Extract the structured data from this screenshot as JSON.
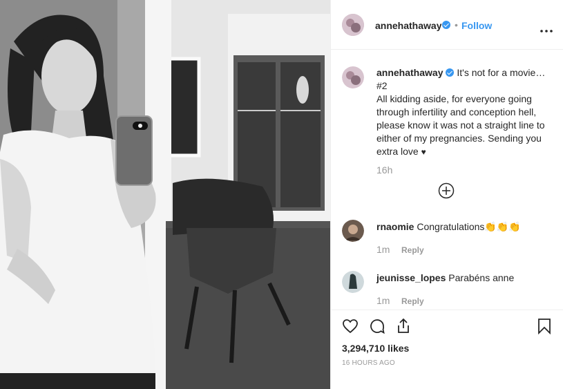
{
  "header": {
    "username": "annehathaway",
    "dot": "•",
    "follow_label": "Follow",
    "more_icon": "more-horizontal-icon"
  },
  "caption": {
    "username": "annehathaway",
    "line1": "It's not for a movie…",
    "line2": "#2",
    "body": "All kidding aside, for everyone going through infertility and conception hell, please know it was not a straight line to either of my pregnancies. Sending you extra love",
    "emoji": "♥",
    "time": "16h"
  },
  "load_more_icon": "plus-circle-icon",
  "comments": [
    {
      "username": "rnaomie",
      "text": "Congratulations👏👏👏",
      "time": "1m",
      "reply": "Reply"
    },
    {
      "username": "jeunisse_lopes",
      "text": "Parabéns anne",
      "time": "1m",
      "reply": "Reply"
    }
  ],
  "actions": {
    "like_icon": "heart-icon",
    "comment_icon": "comment-icon",
    "share_icon": "share-icon",
    "save_icon": "bookmark-icon"
  },
  "likes": "3,294,710 likes",
  "posted": "16 HOURS AGO",
  "colors": {
    "link": "#3897f0",
    "text": "#262626",
    "muted": "#999999",
    "border": "#efefef"
  }
}
